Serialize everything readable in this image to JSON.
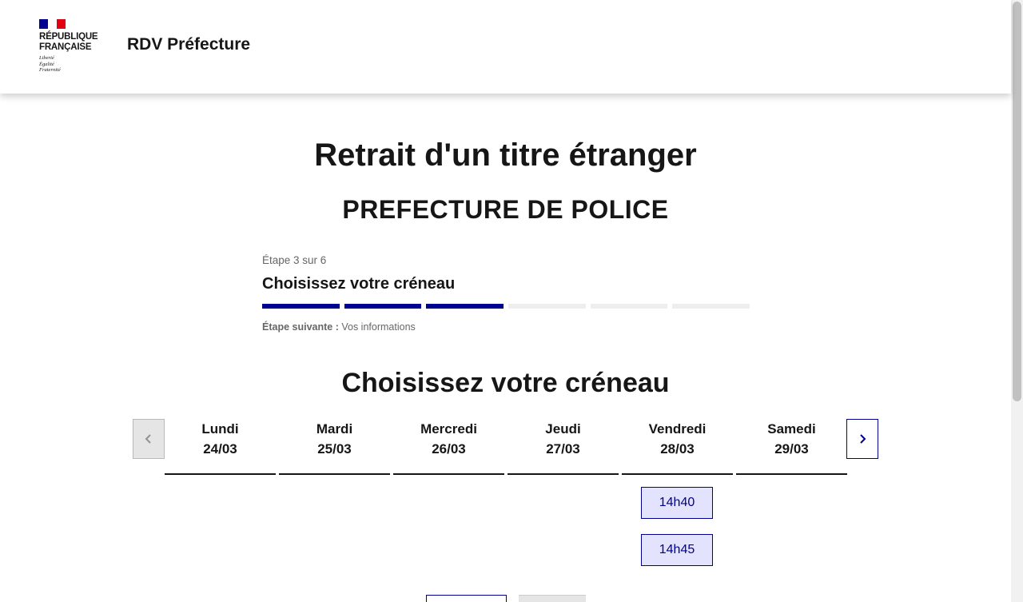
{
  "header": {
    "brand_line1": "RÉPUBLIQUE",
    "brand_line2": "FRANÇAISE",
    "motto_1": "Liberté",
    "motto_2": "Égalité",
    "motto_3": "Fraternité",
    "service_title": "RDV Préfecture"
  },
  "page": {
    "title": "Retrait d'un titre étranger",
    "subtitle": "PREFECTURE DE POLICE"
  },
  "stepper": {
    "step_count": "Étape 3 sur 6",
    "current_title": "Choisissez votre créneau",
    "total_steps": 6,
    "completed_steps": 3,
    "next_label": "Étape suivante :",
    "next_value": "Vos informations"
  },
  "calendar": {
    "section_title": "Choisissez votre créneau",
    "prev_icon": "chevron-left-icon",
    "next_icon": "chevron-right-icon",
    "days": [
      {
        "name": "Lundi",
        "date": "24/03"
      },
      {
        "name": "Mardi",
        "date": "25/03"
      },
      {
        "name": "Mercredi",
        "date": "26/03"
      },
      {
        "name": "Jeudi",
        "date": "27/03"
      },
      {
        "name": "Vendredi",
        "date": "28/03"
      },
      {
        "name": "Samedi",
        "date": "29/03"
      }
    ],
    "slots": [
      {
        "day": "Vendredi",
        "time": "14h40"
      },
      {
        "day": "Vendredi",
        "time": "14h45"
      }
    ]
  },
  "colors": {
    "primary": "#000091",
    "slot_bg": "#e3e3fd",
    "flag_red": "#e1000f",
    "step_inactive": "#eeeeee"
  }
}
